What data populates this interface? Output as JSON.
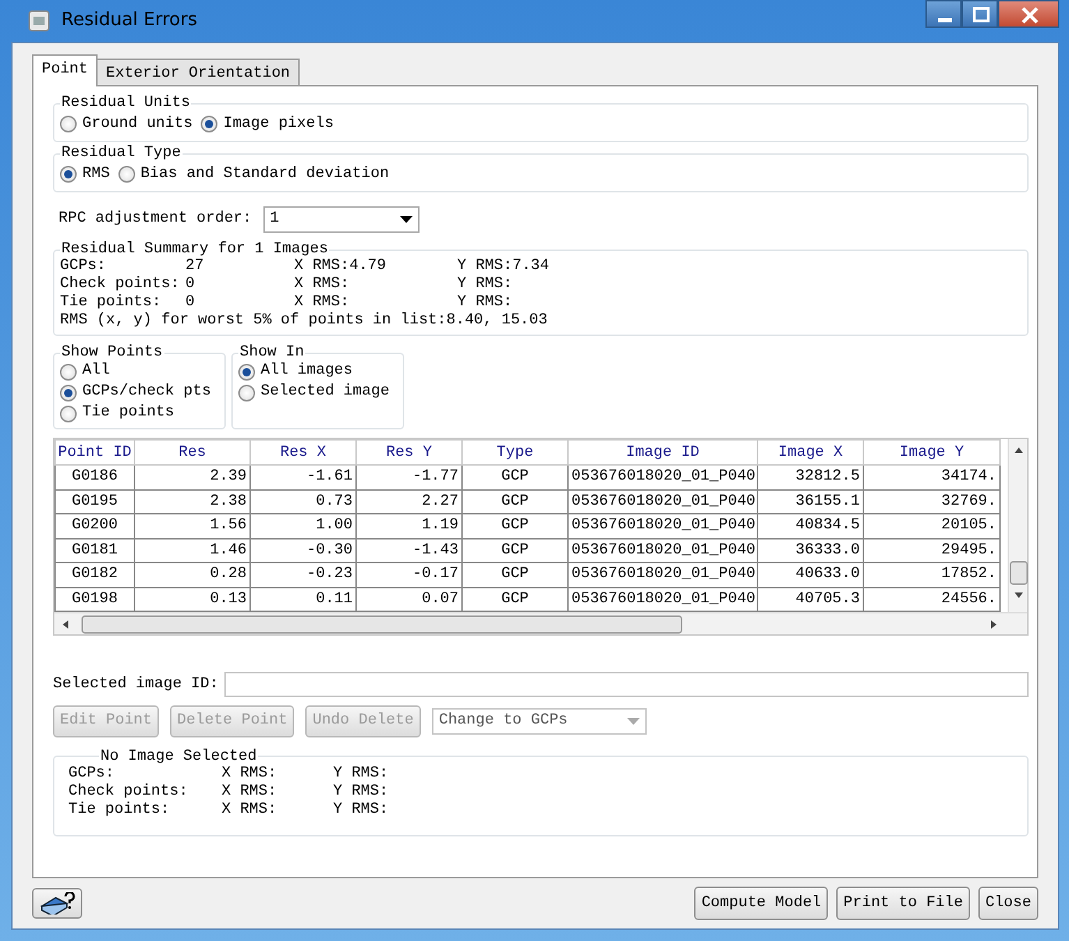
{
  "window": {
    "title": "Residual Errors"
  },
  "tabs": [
    {
      "label": "Point",
      "selected": true
    },
    {
      "label": "Exterior Orientation",
      "selected": false
    }
  ],
  "residual_units": {
    "title": "Residual Units",
    "options": [
      {
        "label": "Ground units",
        "selected": false
      },
      {
        "label": "Image pixels",
        "selected": true
      }
    ]
  },
  "residual_type": {
    "title": "Residual Type",
    "options": [
      {
        "label": "RMS",
        "selected": true
      },
      {
        "label": "Bias and Standard deviation",
        "selected": false
      }
    ]
  },
  "rpc_order": {
    "label": "RPC adjustment order:",
    "value": "1"
  },
  "summary": {
    "title": "Residual Summary for 1 Images",
    "rows": [
      {
        "label": "GCPs:",
        "count": "27",
        "x_rms": "X RMS:4.79",
        "y_rms": "Y RMS:7.34"
      },
      {
        "label": "Check points:",
        "count": "0",
        "x_rms": "X RMS:",
        "y_rms": "Y RMS:"
      },
      {
        "label": "Tie points:",
        "count": "0",
        "x_rms": "X RMS:",
        "y_rms": "Y RMS:"
      }
    ],
    "worst": "RMS (x, y) for worst 5% of points in list:8.40, 15.03"
  },
  "show_points": {
    "title": "Show Points",
    "options": [
      {
        "label": "All",
        "selected": false
      },
      {
        "label": "GCPs/check pts",
        "selected": true
      },
      {
        "label": "Tie points",
        "selected": false
      }
    ]
  },
  "show_in": {
    "title": "Show In",
    "options": [
      {
        "label": "All images",
        "selected": true
      },
      {
        "label": "Selected image",
        "selected": false
      }
    ]
  },
  "table": {
    "columns": [
      "Point ID",
      "Res",
      "Res X",
      "Res Y",
      "Type",
      "Image ID",
      "Image X",
      "Image Y"
    ],
    "rows": [
      [
        "G0186",
        "2.39",
        "-1.61",
        "-1.77",
        "GCP",
        "053676018020_01_P040",
        "32812.5",
        "34174."
      ],
      [
        "G0195",
        "2.38",
        "0.73",
        "2.27",
        "GCP",
        "053676018020_01_P040",
        "36155.1",
        "32769."
      ],
      [
        "G0200",
        "1.56",
        "1.00",
        "1.19",
        "GCP",
        "053676018020_01_P040",
        "40834.5",
        "20105."
      ],
      [
        "G0181",
        "1.46",
        "-0.30",
        "-1.43",
        "GCP",
        "053676018020_01_P040",
        "36333.0",
        "29495."
      ],
      [
        "G0182",
        "0.28",
        "-0.23",
        "-0.17",
        "GCP",
        "053676018020_01_P040",
        "40633.0",
        "17852."
      ],
      [
        "G0198",
        "0.13",
        "0.11",
        "0.07",
        "GCP",
        "053676018020_01_P040",
        "40705.3",
        "24556."
      ]
    ]
  },
  "selected_image": {
    "label": "Selected image ID:"
  },
  "actions": [
    {
      "label": "Edit Point",
      "disabled": true
    },
    {
      "label": "Delete Point",
      "disabled": true
    },
    {
      "label": "Undo Delete",
      "disabled": true
    }
  ],
  "change_type": {
    "value": "Change to GCPs",
    "disabled": true
  },
  "image_stats": {
    "title": "No Image Selected",
    "rows": [
      {
        "label": "GCPs:",
        "x_rms": "X RMS:",
        "y_rms": "Y RMS:"
      },
      {
        "label": "Check points:",
        "x_rms": "X RMS:",
        "y_rms": "Y RMS:"
      },
      {
        "label": "Tie points:",
        "x_rms": "X RMS:",
        "y_rms": "Y RMS:"
      }
    ]
  },
  "footer_buttons": [
    {
      "label": "Compute Model"
    },
    {
      "label": "Print to File"
    },
    {
      "label": "Close"
    }
  ]
}
